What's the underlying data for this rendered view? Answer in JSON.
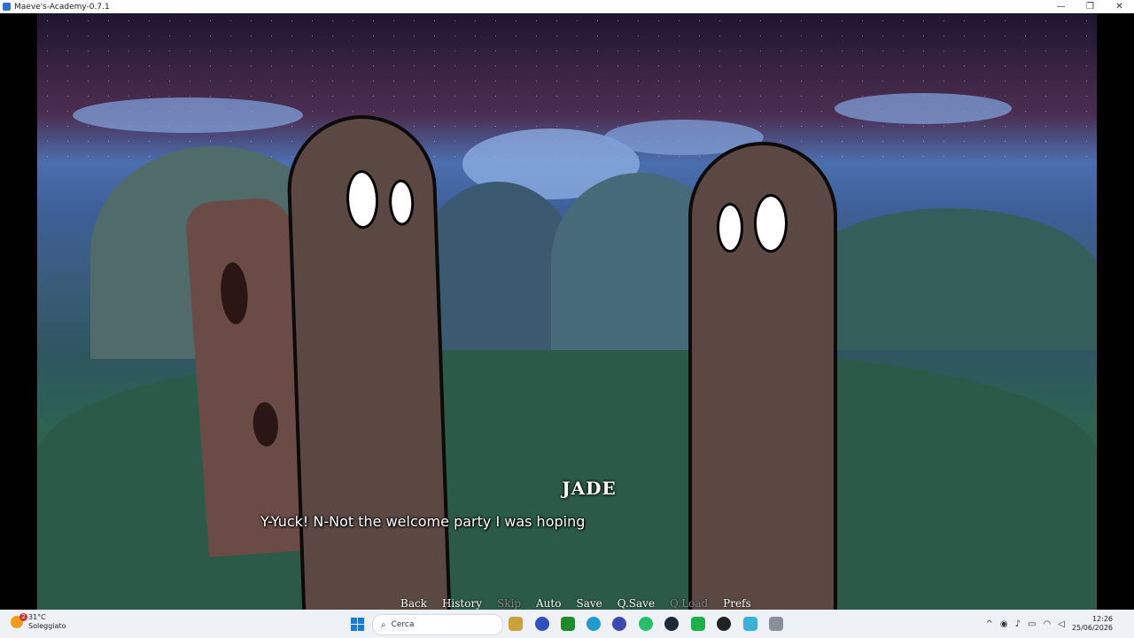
{
  "window": {
    "title": "Maeve's-Academy-0.7.1",
    "controls": [
      "—",
      "❐",
      "✕"
    ]
  },
  "dialogue": {
    "speaker": "JADE",
    "text": "Y-Yuck! N-Not the welcome party I was hoping"
  },
  "quick_menu": {
    "back": "Back",
    "history": "History",
    "skip": "Skip",
    "auto": "Auto",
    "save": "Save",
    "qsave": "Q.Save",
    "qload": "Q.Load",
    "prefs": "Prefs"
  },
  "taskbar": {
    "weather_badge": "2",
    "weather_temp": "31°C",
    "weather_cond": "Soleggiato",
    "search_placeholder": "Cerca",
    "time": "12:26",
    "date": "25/06/2026"
  },
  "colors": {
    "taskbar_bg": "#eef1f6",
    "dialogue_text": "#ffffff",
    "disabled_menu": "#8a8a8a"
  }
}
